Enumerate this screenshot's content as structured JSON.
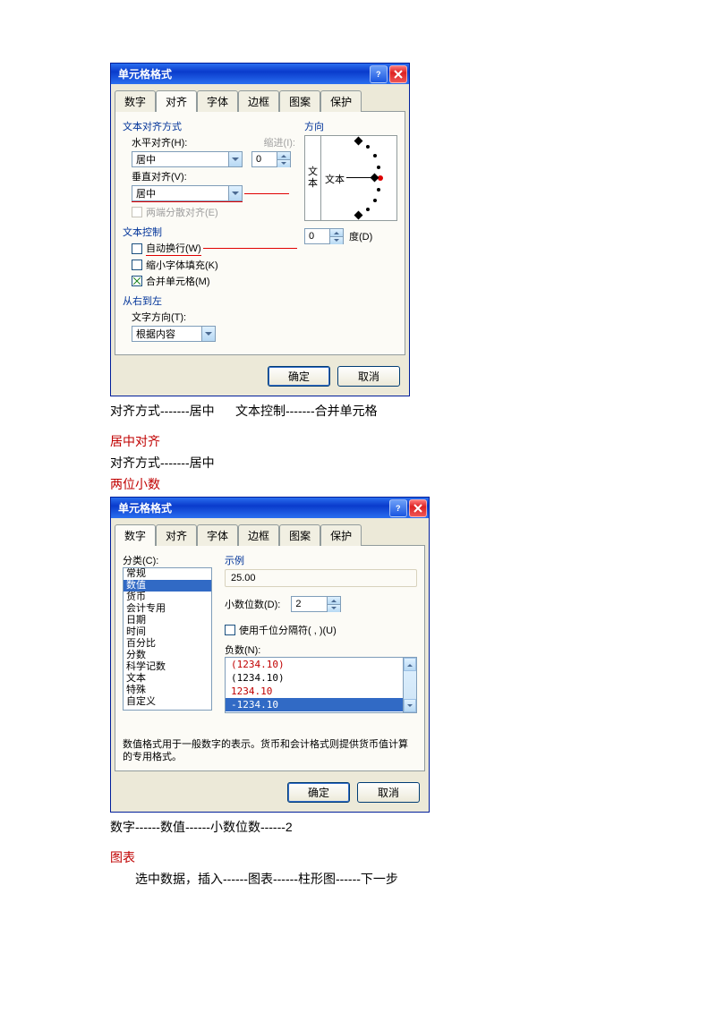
{
  "dialog1": {
    "title": "单元格格式",
    "tabs": [
      "数字",
      "对齐",
      "字体",
      "边框",
      "图案",
      "保护"
    ],
    "active_tab": "对齐",
    "sec_align": "文本对齐方式",
    "h_label": "水平对齐(H):",
    "h_val": "居中",
    "indent_label": "缩进(I):",
    "indent_val": "0",
    "v_label": "垂直对齐(V):",
    "v_val": "居中",
    "justify_dist": "两端分散对齐(E)",
    "sec_text_ctrl": "文本控制",
    "wrap": "自动换行(W)",
    "shrink": "缩小字体填充(K)",
    "merge": "合并单元格(M)",
    "sec_rtl": "从右到左",
    "text_dir_label": "文字方向(T):",
    "text_dir_val": "根据内容",
    "sec_orient": "方向",
    "orient_text_v": "文本",
    "orient_text_h": "文本",
    "deg_val": "0",
    "deg_label": "度(D)",
    "ok": "确定",
    "cancel": "取消"
  },
  "note1": "对齐方式-------居中      文本控制-------合并单元格",
  "heading2": "居中对齐",
  "note2": "对齐方式-------居中",
  "heading3": "两位小数",
  "dialog2": {
    "title": "单元格格式",
    "tabs": [
      "数字",
      "对齐",
      "字体",
      "边框",
      "图案",
      "保护"
    ],
    "active_tab": "数字",
    "cat_label": "分类(C):",
    "categories": [
      "常规",
      "数值",
      "货币",
      "会计专用",
      "日期",
      "时间",
      "百分比",
      "分数",
      "科学记数",
      "文本",
      "特殊",
      "自定义"
    ],
    "cat_selected": "数值",
    "sample_label": "示例",
    "sample_val": "25.00",
    "decimal_label": "小数位数(D):",
    "decimal_val": "2",
    "thousand_sep": "使用千位分隔符( , )(U)",
    "neg_label": "负数(N):",
    "neg_items": [
      {
        "text": "(1234.10)",
        "color": "#c00000"
      },
      {
        "text": "(1234.10)",
        "color": "#000"
      },
      {
        "text": "1234.10",
        "color": "#c00000"
      },
      {
        "text": "-1234.10",
        "color": "#fff",
        "bg": "#316ac5"
      }
    ],
    "desc": "数值格式用于一般数字的表示。货币和会计格式则提供货币值计算的专用格式。",
    "ok": "确定",
    "cancel": "取消"
  },
  "note3": "数字------数值------小数位数------2",
  "heading4": "图表",
  "note4": "选中数据，插入------图表------柱形图------下一步"
}
